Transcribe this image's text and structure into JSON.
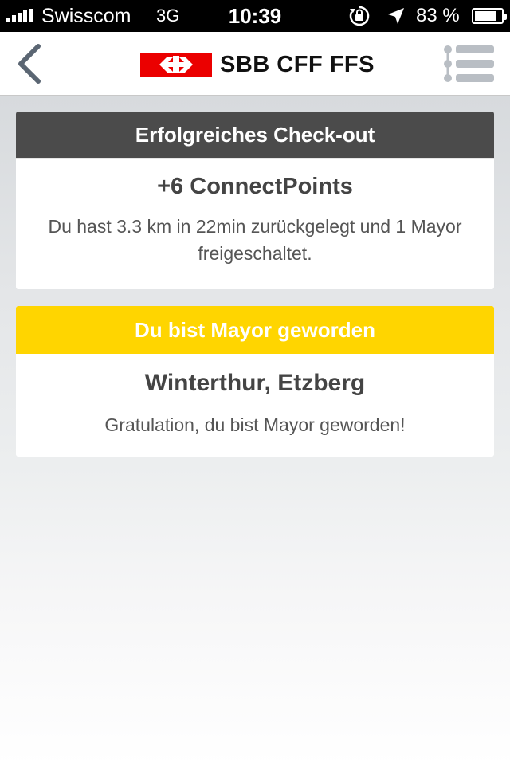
{
  "status_bar": {
    "carrier": "Swisscom",
    "network": "3G",
    "time": "10:39",
    "battery_percent": "83 %",
    "battery_level": 0.83,
    "icons": [
      "signal-icon",
      "rotation-lock-icon",
      "location-arrow-icon",
      "battery-icon"
    ]
  },
  "nav": {
    "brand": "SBB CFF FFS",
    "brand_color": "#eb0000",
    "icons": [
      "back-chevron-icon",
      "sbb-logo-icon",
      "menu-list-icon"
    ]
  },
  "cards": {
    "checkout": {
      "header": "Erfolgreiches Check-out",
      "title": "+6 ConnectPoints",
      "text": "Du hast 3.3 km in 22min zurückgelegt und 1 Mayor freigeschaltet.",
      "header_color": "#4b4b4b"
    },
    "mayor": {
      "header": "Du bist Mayor geworden",
      "title": "Winterthur, Etzberg",
      "text": "Gratulation, du bist Mayor geworden!",
      "header_color": "#ffd500"
    }
  }
}
